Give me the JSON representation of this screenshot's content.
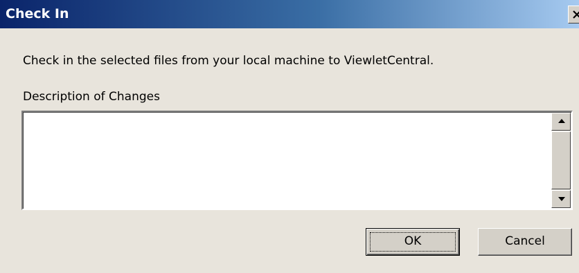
{
  "window": {
    "title": "Check In",
    "close_icon": "close-icon"
  },
  "dialog": {
    "message": "Check in the selected files from your local machine to ViewletCentral.",
    "description_label": "Description of Changes",
    "description_value": ""
  },
  "scrollbar": {
    "up_icon": "arrow-up-icon",
    "down_icon": "arrow-down-icon"
  },
  "buttons": {
    "ok_label": "OK",
    "cancel_label": "Cancel"
  },
  "colors": {
    "titlebar_start": "#0a246a",
    "titlebar_end": "#a6caf0",
    "dialog_bg": "#e8e4dc"
  }
}
